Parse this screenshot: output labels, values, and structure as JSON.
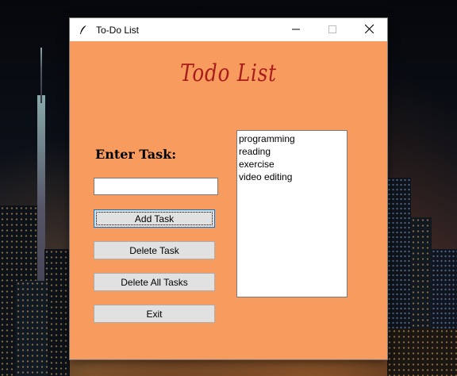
{
  "window": {
    "title": "To-Do List",
    "icon": "feather-icon",
    "controls": [
      "minimize-icon",
      "maximize-icon",
      "close-icon"
    ]
  },
  "app": {
    "heading": "Todo List",
    "enter_task_label": "Enter Task:",
    "task_input_value": "",
    "buttons": {
      "add": "Add Task",
      "delete": "Delete Task",
      "delete_all": "Delete All Tasks",
      "exit": "Exit"
    },
    "tasks": [
      "programming",
      "reading",
      "exercise",
      "video editing"
    ]
  },
  "colors": {
    "window_background": "#f79c5e",
    "heading_color": "#a81c1c",
    "button_background": "#e1e1e1"
  }
}
